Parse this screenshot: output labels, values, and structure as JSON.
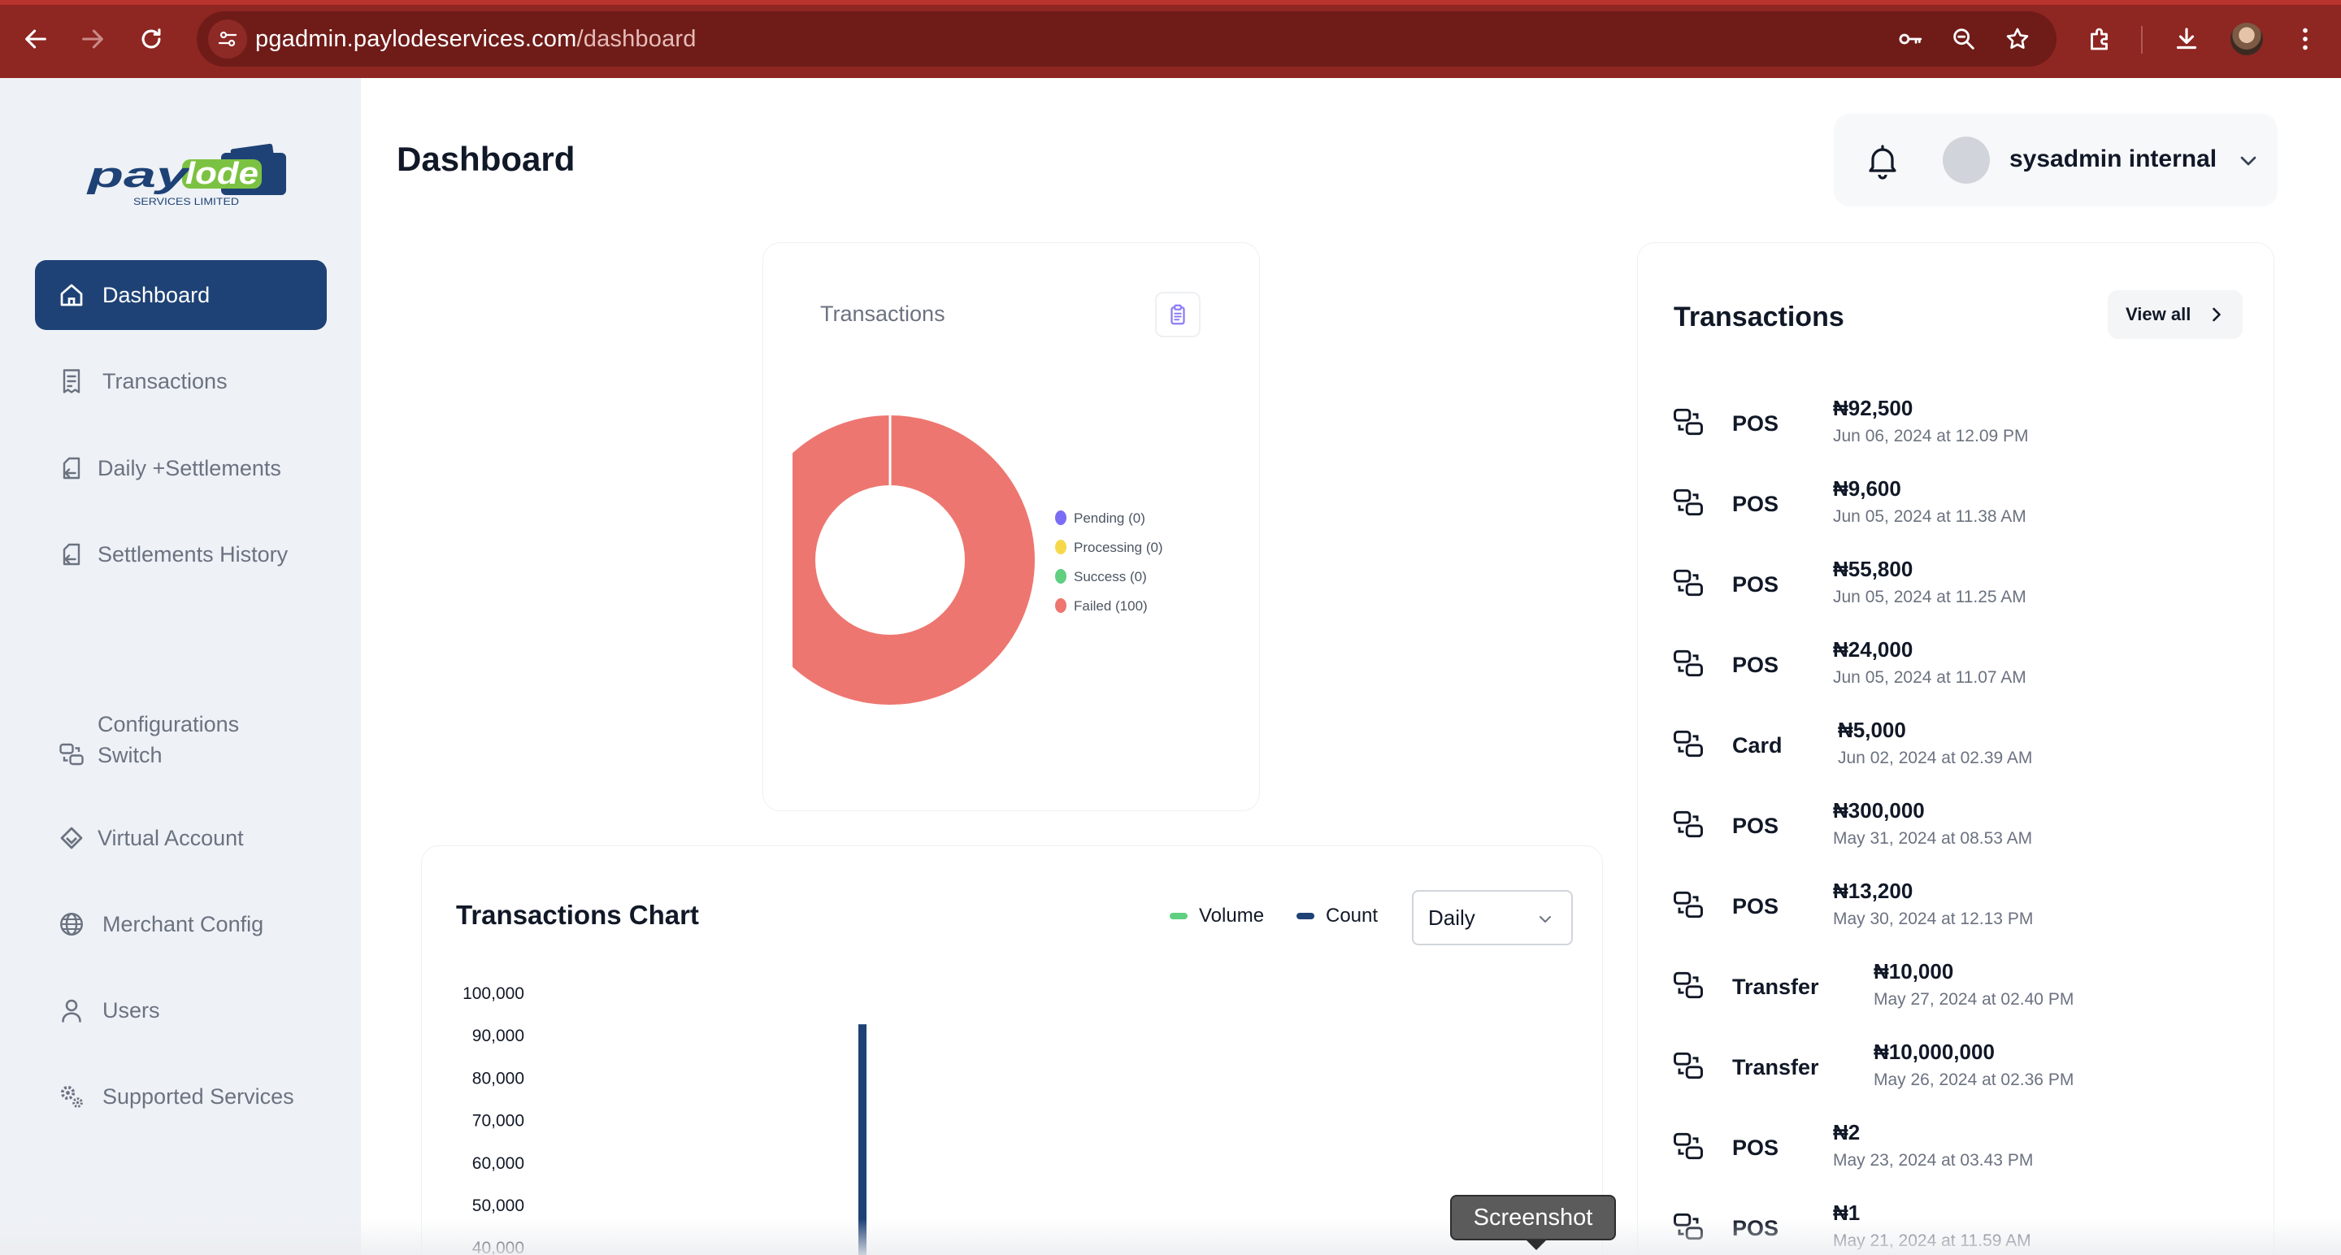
{
  "browser": {
    "url_domain": "pgadmin.paylodeservices.com",
    "url_path": "/dashboard"
  },
  "brand": {
    "logo_text": "paylode",
    "logo_subtext": "SERVICES LIMITED",
    "primary_color": "#1e4275",
    "accent_color": "#7cc242"
  },
  "sidebar": {
    "items": [
      {
        "label": "Dashboard",
        "icon": "home-icon",
        "active": true
      },
      {
        "label": "Transactions",
        "icon": "receipt-icon",
        "active": false
      },
      {
        "label": "Daily +Settlements",
        "icon": "settlement-icon",
        "active": false
      },
      {
        "label": "Settlements History",
        "icon": "history-icon",
        "active": false
      },
      {
        "label": "Configurations Switch",
        "icon": "switch-icon",
        "active": false
      },
      {
        "label": "Virtual Account",
        "icon": "diamond-icon",
        "active": false
      },
      {
        "label": "Merchant Config",
        "icon": "globe-icon",
        "active": false
      },
      {
        "label": "Users",
        "icon": "user-icon",
        "active": false
      },
      {
        "label": "Supported Services",
        "icon": "gears-icon",
        "active": false
      }
    ]
  },
  "header": {
    "title": "Dashboard",
    "user_name": "sysadmin internal"
  },
  "status_card": {
    "title": "Transactions",
    "chart_data": {
      "type": "pie",
      "labels": [
        "Pending (0)",
        "Processing (0)",
        "Success (0)",
        "Failed (100)"
      ],
      "values": [
        0,
        0,
        0,
        100
      ],
      "colors": [
        "#7b6cf6",
        "#f5d94a",
        "#5fcf80",
        "#ee7670"
      ],
      "legend_position": "right"
    }
  },
  "transactions_list": {
    "title": "Transactions",
    "view_all": "View all",
    "items": [
      {
        "type": "POS",
        "amount": "₦92,500",
        "date": "Jun 06, 2024 at 12.09 PM"
      },
      {
        "type": "POS",
        "amount": "₦9,600",
        "date": "Jun 05, 2024 at 11.38 AM"
      },
      {
        "type": "POS",
        "amount": "₦55,800",
        "date": "Jun 05, 2024 at 11.25 AM"
      },
      {
        "type": "POS",
        "amount": "₦24,000",
        "date": "Jun 05, 2024 at 11.07 AM"
      },
      {
        "type": "Card",
        "amount": "₦5,000",
        "date": "Jun 02, 2024 at 02.39 AM"
      },
      {
        "type": "POS",
        "amount": "₦300,000",
        "date": "May 31, 2024 at 08.53 AM"
      },
      {
        "type": "POS",
        "amount": "₦13,200",
        "date": "May 30, 2024 at 12.13 PM"
      },
      {
        "type": "Transfer",
        "amount": "₦10,000",
        "date": "May 27, 2024 at 02.40 PM"
      },
      {
        "type": "Transfer",
        "amount": "₦10,000,000",
        "date": "May 26, 2024 at 02.36 PM"
      },
      {
        "type": "POS",
        "amount": "₦2",
        "date": "May 23, 2024 at 03.43 PM"
      },
      {
        "type": "POS",
        "amount": "₦1",
        "date": "May 21, 2024 at 11.59 AM"
      }
    ]
  },
  "transactions_chart": {
    "title": "Transactions Chart",
    "period": "Daily",
    "chart_data": {
      "type": "bar",
      "series": [
        {
          "name": "Volume",
          "color": "#5fcf80",
          "values": []
        },
        {
          "name": "Count",
          "color": "#1e4275",
          "values": [
            92500
          ]
        }
      ],
      "yticks": [
        "100,000",
        "90,000",
        "80,000",
        "70,000",
        "60,000",
        "50,000",
        "40,000"
      ],
      "ylim": [
        40000,
        100000
      ],
      "legend_position": "top-right",
      "grid": false
    }
  },
  "tooltip": {
    "text": "Screenshot"
  }
}
